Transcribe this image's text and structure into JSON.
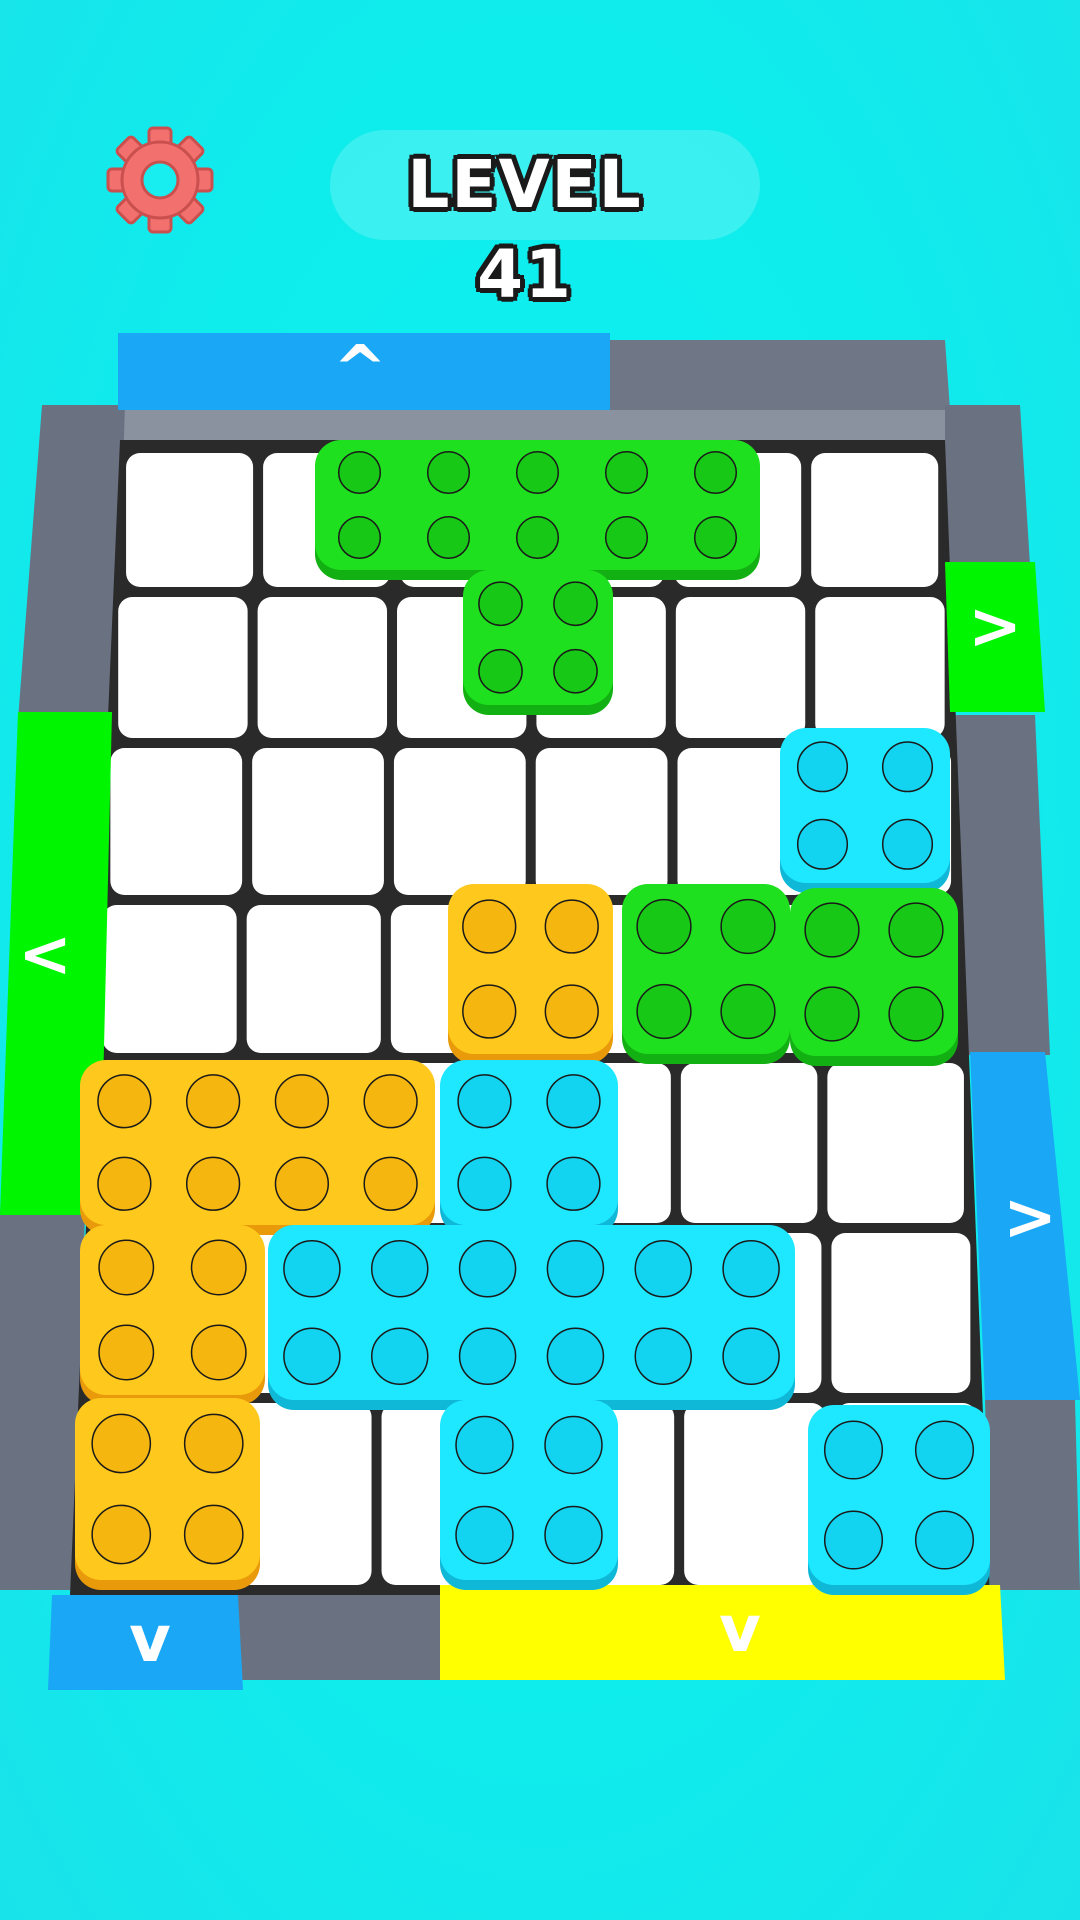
{
  "hud": {
    "level_label": "LEVEL 41",
    "settings_icon": "gear-icon",
    "settings_color": "#f2706e"
  },
  "colors": {
    "green": "#1fe01f",
    "yellow": "#ffc81c",
    "cyan": "#1ee8ff",
    "blue_gate": "#1aa7f5",
    "yellow_gate": "#ffff00",
    "green_gate": "#00f500",
    "wall": "#6a7282",
    "cell": "#ffffff",
    "grid_line": "#2a2a2a"
  },
  "board": {
    "cols": 5,
    "rows": 7,
    "blocks": [
      {
        "color": "green",
        "cells": [
          [
            0,
            1
          ],
          [
            0,
            2
          ],
          [
            1,
            2
          ],
          [
            2,
            1
          ],
          [
            2,
            2
          ],
          [
            3,
            1
          ],
          [
            3,
            2
          ]
        ]
      },
      {
        "color": "cyan",
        "cells": [
          [
            3,
            4
          ]
        ]
      },
      {
        "color": "yellow",
        "cells": [
          [
            1,
            5
          ]
        ]
      },
      {
        "color": "green",
        "cells": [
          [
            2,
            5
          ]
        ]
      },
      {
        "color": "green",
        "cells": [
          [
            3,
            5
          ]
        ]
      },
      {
        "color": "yellow",
        "cells": [
          [
            -1,
            6
          ],
          [
            0,
            6
          ],
          [
            -1,
            7
          ],
          [
            -1,
            8
          ]
        ]
      },
      {
        "color": "cyan",
        "cells": [
          [
            1,
            6
          ],
          [
            1,
            7
          ],
          [
            0,
            7
          ],
          [
            2,
            7
          ],
          [
            1,
            8
          ]
        ]
      },
      {
        "color": "yellow",
        "cells": [
          [
            -1,
            9
          ]
        ]
      },
      {
        "color": "cyan",
        "cells": [
          [
            3,
            9
          ]
        ]
      }
    ],
    "gates": [
      {
        "name": "top-left-gate",
        "color": "blue_gate",
        "arrow": "^",
        "direction": "up"
      },
      {
        "name": "right-upper-gate",
        "color": "green_gate",
        "arrow": ">",
        "direction": "right"
      },
      {
        "name": "left-gate",
        "color": "green_gate",
        "arrow": "<",
        "direction": "left"
      },
      {
        "name": "right-lower-gate",
        "color": "blue_gate",
        "arrow": ">",
        "direction": "right"
      },
      {
        "name": "bottom-left-gate",
        "color": "blue_gate",
        "arrow": "v",
        "direction": "down"
      },
      {
        "name": "bottom-right-gate",
        "color": "yellow_gate",
        "arrow": "v",
        "direction": "down"
      }
    ]
  }
}
